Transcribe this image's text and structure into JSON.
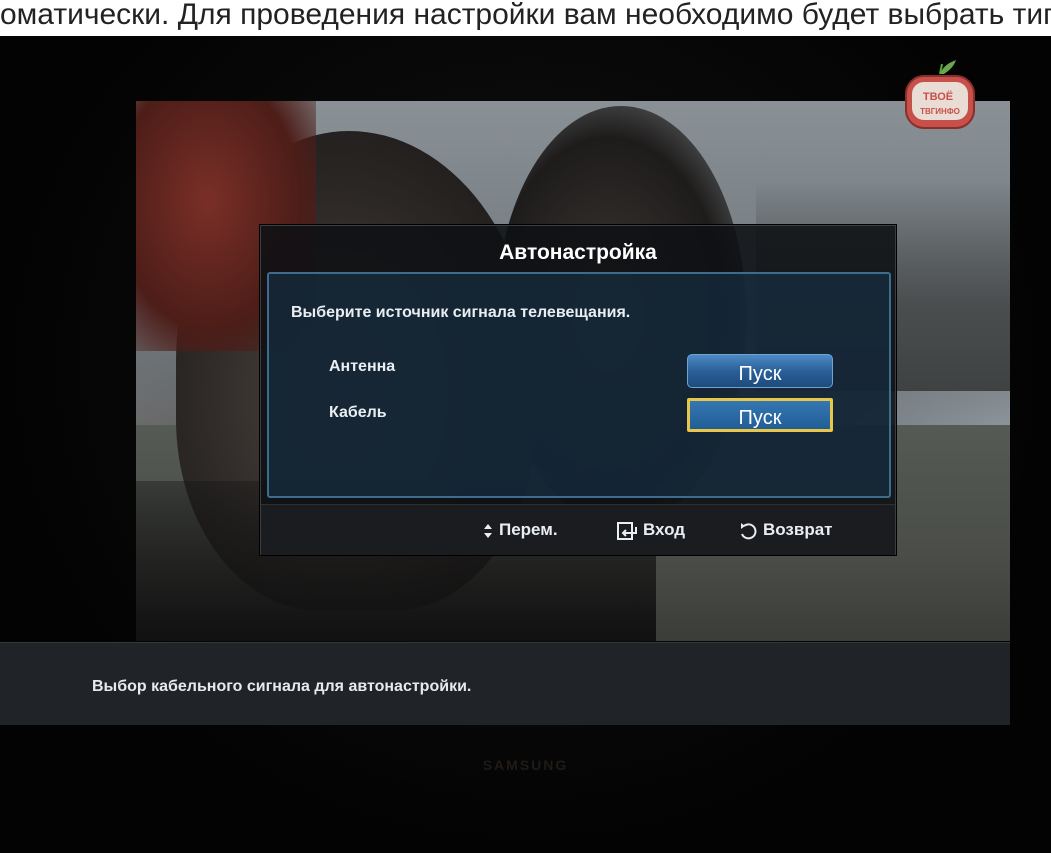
{
  "top_caption": "оматически. Для проведения настройки вам необходимо будет выбрать тип подключения: кабельное или антенну",
  "dialog": {
    "title": "Автонастройка",
    "prompt": "Выберите источник сигнала телевещания.",
    "options": [
      {
        "label": "Антенна",
        "button": "Пуск",
        "focused": false
      },
      {
        "label": "Кабель",
        "button": "Пуск",
        "focused": true
      }
    ],
    "footer": {
      "move": "Перем.",
      "enter": "Вход",
      "return": "Возврат"
    }
  },
  "info_bar": {
    "text": "Выбор кабельного сигнала для автонастройки."
  },
  "brand": "SAMSUNG",
  "watermark": {
    "text_top": "ТВОЁ",
    "text_bottom": "ТВГИНФО"
  },
  "colors": {
    "focus_border": "#e7c64a",
    "button_blue": "#2a6098",
    "panel_border": "#3d6d8c",
    "watermark_red": "#c8504a"
  },
  "icons": [
    "updown-arrows-icon",
    "enter-icon",
    "return-icon",
    "tv-logo-icon"
  ]
}
